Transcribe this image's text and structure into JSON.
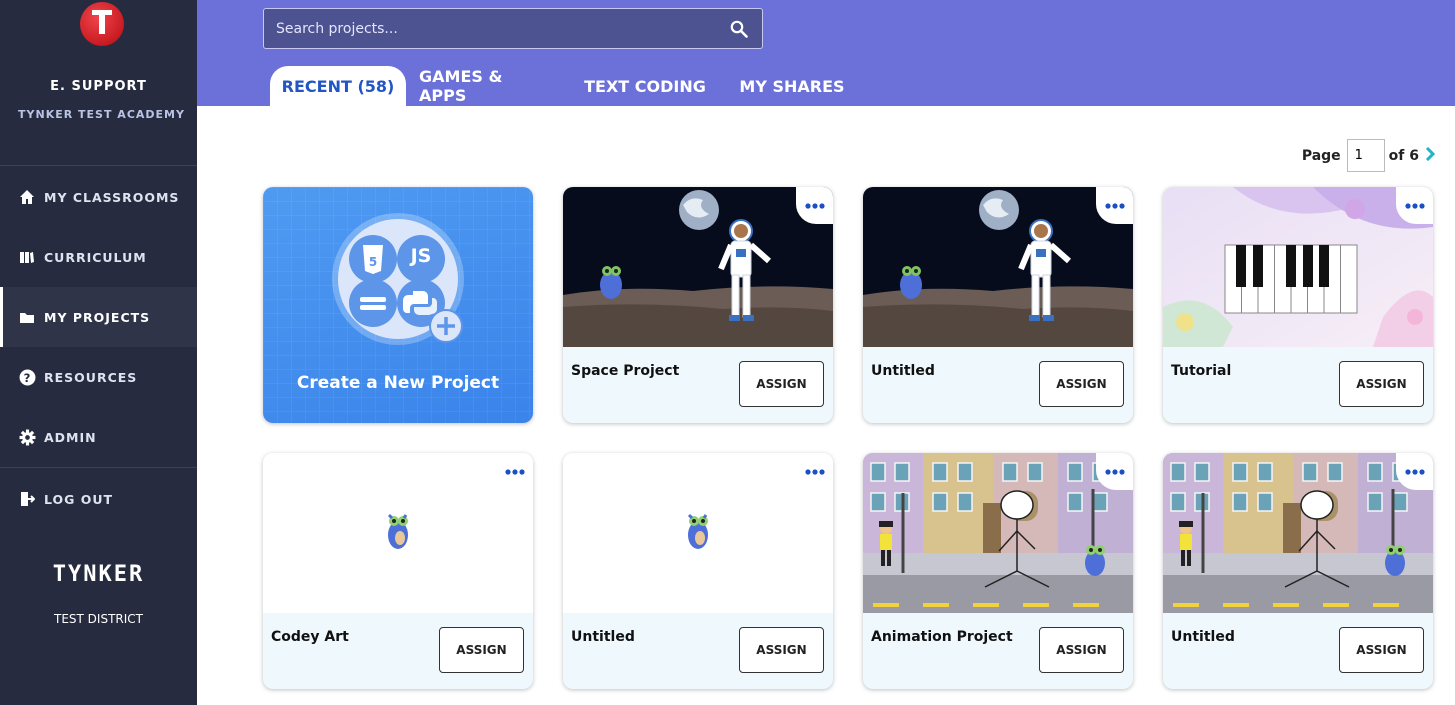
{
  "sidebar": {
    "user_name": "E. SUPPORT",
    "school": "TYNKER TEST ACADEMY",
    "items": [
      {
        "label": "MY CLASSROOMS",
        "icon": "home-icon"
      },
      {
        "label": "CURRICULUM",
        "icon": "book-icon"
      },
      {
        "label": "MY PROJECTS",
        "icon": "folder-icon",
        "active": true
      },
      {
        "label": "RESOURCES",
        "icon": "help-icon"
      },
      {
        "label": "ADMIN",
        "icon": "gear-icon"
      },
      {
        "label": "LOG OUT",
        "icon": "logout-icon"
      }
    ],
    "brand": "TYNKER",
    "district": "TEST DISTRICT"
  },
  "search": {
    "placeholder": "Search projects..."
  },
  "tabs": [
    {
      "label": "RECENT (58)",
      "active": true
    },
    {
      "label": "GAMES & APPS"
    },
    {
      "label": "TEXT CODING"
    },
    {
      "label": "MY SHARES"
    }
  ],
  "pagination": {
    "page_label": "Page",
    "current": "1",
    "of_label": "of 6"
  },
  "create_card": {
    "label": "Create a New Project",
    "badges": [
      "JS"
    ]
  },
  "assign_label": "ASSIGN",
  "projects": [
    {
      "title": "Space Project",
      "thumbnail": "space"
    },
    {
      "title": "Untitled",
      "thumbnail": "space"
    },
    {
      "title": "Tutorial",
      "thumbnail": "piano"
    },
    {
      "title": "Codey Art",
      "thumbnail": "codey"
    },
    {
      "title": "Untitled",
      "thumbnail": "codey"
    },
    {
      "title": "Animation Project",
      "thumbnail": "street"
    },
    {
      "title": "Untitled",
      "thumbnail": "street"
    }
  ],
  "colors": {
    "sidebar": "#262b3f",
    "header": "#6b71d9",
    "accent": "#2156c4",
    "card_bg": "#eff9fd"
  }
}
